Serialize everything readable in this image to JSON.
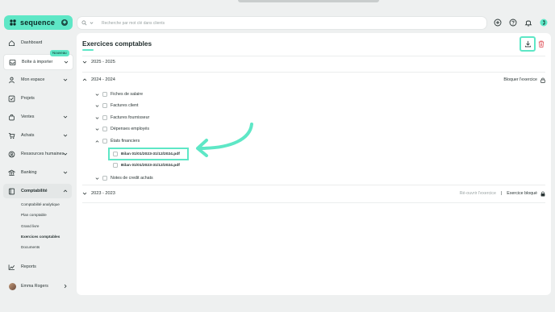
{
  "app": {
    "brand": "sequence"
  },
  "sidebar": {
    "items": [
      {
        "label": "Dashboard",
        "icon": "home-icon"
      },
      {
        "label": "Boîte à importer",
        "icon": "inbox-icon",
        "badge": "Nouveau"
      },
      {
        "label": "Mon espace",
        "icon": "person-icon"
      },
      {
        "label": "Projets",
        "icon": "checkbox-icon"
      },
      {
        "label": "Ventes",
        "icon": "bag-icon"
      },
      {
        "label": "Achats",
        "icon": "cart-icon"
      },
      {
        "label": "Ressources humaines",
        "icon": "people-icon"
      },
      {
        "label": "Banking",
        "icon": "bank-icon"
      },
      {
        "label": "Comptabilité",
        "icon": "ledger-icon"
      },
      {
        "label": "Reports",
        "icon": "chart-icon"
      }
    ],
    "sub_items": [
      "Comptabilité analytique",
      "Plan comptable",
      "Grand livre",
      "Exercices comptables",
      "Documents"
    ],
    "user": {
      "name": "Emma Rogers"
    }
  },
  "search": {
    "placeholder": "Recherche par mot clé dans clients",
    "value": ""
  },
  "main": {
    "title": "Exercices comptables",
    "years": [
      {
        "label": "2025 - 2025"
      },
      {
        "label": "2024 - 2024",
        "action": "Bloquer l'exercice"
      },
      {
        "label": "2023 - 2023",
        "reopen": "Ré-ouvrir l'exercice",
        "status": "Exercice bloqué"
      }
    ],
    "folders": [
      "Fiches de salaire",
      "Factures client",
      "Factures fournisseur",
      "Dépenses employés",
      "États financiers",
      "Notes de credit achats"
    ],
    "files": [
      "Bilan 01/01/2023-31/12/2024.pdf",
      "Bilan 01/01/2023-31/12/2024.pdf"
    ]
  },
  "colors": {
    "accent": "#5ee7c6",
    "danger": "#e0525a",
    "brand_dark": "#0e2a27"
  }
}
